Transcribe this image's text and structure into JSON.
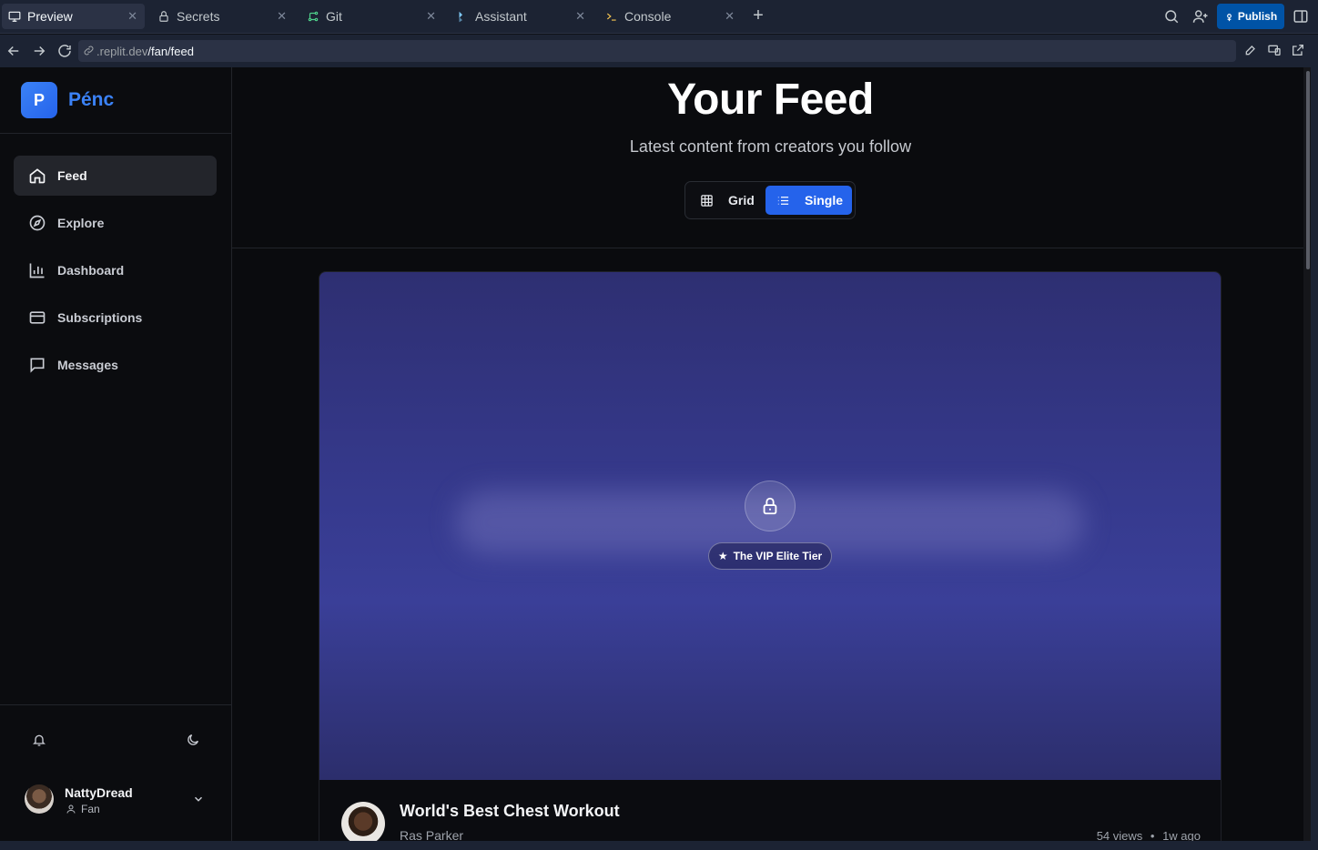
{
  "tabs": [
    {
      "label": "Preview",
      "icon": "monitor-icon",
      "active": true
    },
    {
      "label": "Secrets",
      "icon": "lock-icon",
      "active": false
    },
    {
      "label": "Git",
      "icon": "git-icon",
      "active": false
    },
    {
      "label": "Assistant",
      "icon": "assistant-icon",
      "active": false
    },
    {
      "label": "Console",
      "icon": "terminal-icon",
      "active": false
    }
  ],
  "toolbar": {
    "publish_label": "Publish"
  },
  "url": {
    "host": ".replit.dev",
    "path": "/fan/feed"
  },
  "brand": {
    "logo_letter": "P",
    "name": "Pénc",
    "accent": "#3b82f6"
  },
  "nav": [
    {
      "label": "Feed",
      "icon": "home-icon",
      "active": true
    },
    {
      "label": "Explore",
      "icon": "compass-icon",
      "active": false
    },
    {
      "label": "Dashboard",
      "icon": "bar-chart-icon",
      "active": false
    },
    {
      "label": "Subscriptions",
      "icon": "credit-card-icon",
      "active": false
    },
    {
      "label": "Messages",
      "icon": "message-icon",
      "active": false
    }
  ],
  "user": {
    "name": "NattyDread",
    "role": "Fan"
  },
  "feed": {
    "title": "Your Feed",
    "subtitle": "Latest content from creators you follow",
    "view_options": [
      {
        "label": "Grid",
        "icon": "grid-icon",
        "active": false
      },
      {
        "label": "Single",
        "icon": "list-icon",
        "active": true
      }
    ]
  },
  "post": {
    "tier": "The VIP Elite Tier",
    "title": "World's Best Chest Workout",
    "creator": "Ras Parker",
    "views": "54 views",
    "separator": "•",
    "age": "1w ago"
  }
}
